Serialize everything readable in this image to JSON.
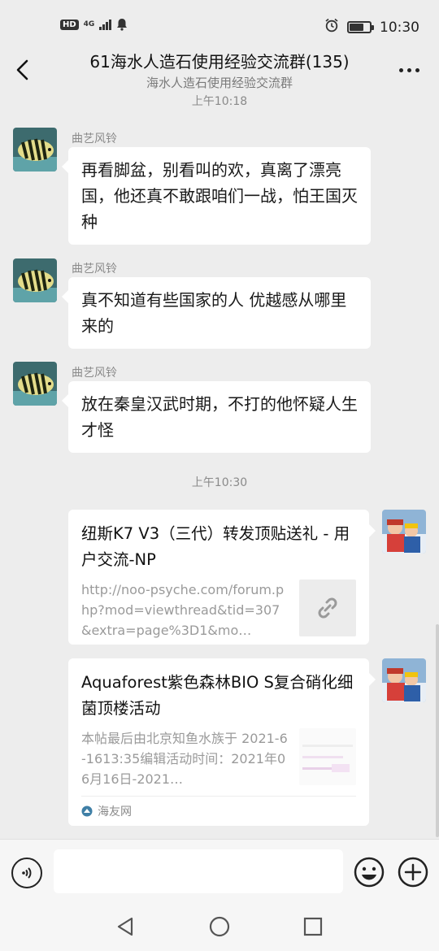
{
  "status_bar": {
    "hd_badge": "HD",
    "network": "4G",
    "time": "10:30",
    "battery_level": 0.72
  },
  "header": {
    "title": "61海水人造石使用经验交流群(135)",
    "subtitle": "海水人造石使用经验交流群"
  },
  "messages": {
    "timestamp_top": "上午10:18",
    "sender": "曲艺风铃",
    "msg1": "再看脚盆，别看叫的欢，真离了漂亮国，他还真不敢跟咱们一战，怕王国灭种",
    "msg2": "真不知道有些国家的人 优越感从哪里来的",
    "msg3": "放在秦皇汉武时期，不打的他怀疑人生才怪",
    "timestamp_mid": "上午10:30"
  },
  "cards": {
    "card1_title": "纽斯K7 V3（三代）转发顶贴送礼 - 用户交流-NP",
    "card1_desc": "http://noo-psyche.com/forum.php?mod=viewthread&tid=307&extra=page%3D1&mo…",
    "card2_title": "Aquaforest紫色森林BIO S复合硝化细菌顶楼活动",
    "card2_desc": "本帖最后由北京知鱼水族于 2021-6-1613:35编辑活动时间：2021年06月16日-2021…",
    "card2_source": "海友网"
  },
  "colors": {
    "background": "#ededed",
    "bubble": "#ffffff",
    "muted_text": "#8a8a8a"
  }
}
